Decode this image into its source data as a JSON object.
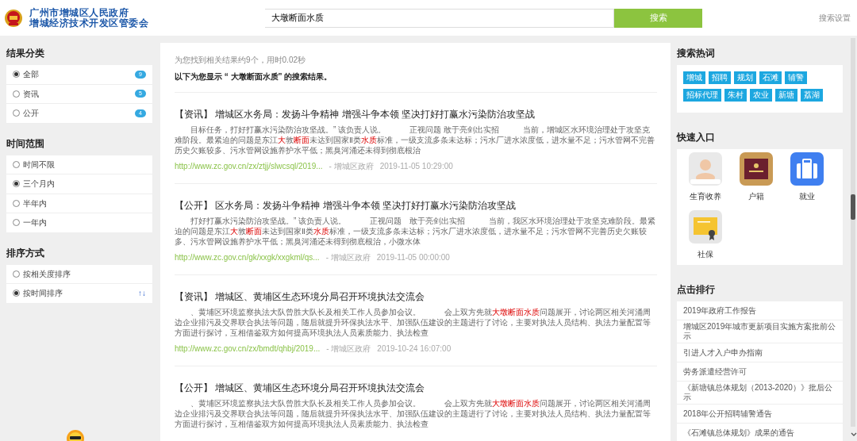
{
  "header": {
    "logo_line1": "广州市增城区人民政府",
    "logo_line2": "增城经济技术开发区管委会",
    "search": {
      "value": "大墩断面水质"
    },
    "search_button": "搜索",
    "settings_link": "搜索设置"
  },
  "filters": [
    {
      "title": "结果分类",
      "options": [
        {
          "label": "全部",
          "selected": true,
          "count": "9"
        },
        {
          "label": "资讯",
          "selected": false,
          "count": "5"
        },
        {
          "label": "公开",
          "selected": false,
          "count": "4"
        }
      ]
    },
    {
      "title": "时间范围",
      "options": [
        {
          "label": "时间不限",
          "selected": false
        },
        {
          "label": "三个月内",
          "selected": true
        },
        {
          "label": "半年内",
          "selected": false
        },
        {
          "label": "一年内",
          "selected": false
        }
      ]
    },
    {
      "title": "排序方式",
      "options": [
        {
          "label": "按相关度排序",
          "selected": false
        },
        {
          "label": "按时间排序",
          "selected": true,
          "arrows": "↑↓"
        }
      ]
    }
  ],
  "results": {
    "summary": "为您找到相关结果约9个，用时0.02秒",
    "query_line": "以下为您显示 “ 大墩断面水质” 的搜索结果。",
    "items": [
      {
        "category": "【资讯】",
        "title": "增城区水务局：发扬斗争精神 增强斗争本领 坚决打好打赢水污染防治攻坚战",
        "snippet": [
          {
            "text": "目标任务，打好打赢水污染防治攻坚战。” 该负责人说。　　　正视问题 敢于亮剑出实招　　　当前，增城区水环境治理处于攻坚克难阶段。最紧迫的问题是东江",
            "highlight": false
          },
          {
            "text": "大",
            "highlight": true
          },
          {
            "text": "敦",
            "highlight": false
          },
          {
            "text": "断面",
            "highlight": true
          },
          {
            "text": "未达到国家Ⅱ类",
            "highlight": false
          },
          {
            "text": "水质",
            "highlight": true
          },
          {
            "text": "标准，一级支流多条未达标；污水厂进水浓度低，进水量不足；污水管网不完善历史欠账较多、污水管网设施养护水平低；黑臭河涌还未得到彻底根治",
            "highlight": false
          }
        ],
        "url": "http://www.zc.gov.cn/zx/ztjj/slwcsql/2019...",
        "source": "- 增城区政府",
        "date": "2019-11-05 10:29:00"
      },
      {
        "category": "【公开】",
        "title": "区水务局：发扬斗争精神 增强斗争本领 坚决打好打赢水污染防治攻坚战",
        "snippet": [
          {
            "text": "打好打赢水污染防治攻坚战。” 该负责人说。　　　正视问题　敢于亮剑出实招　　　当前，我区水环境治理处于攻坚克难阶段。最紧迫的问题是东江",
            "highlight": false
          },
          {
            "text": "大",
            "highlight": true
          },
          {
            "text": "敦",
            "highlight": false
          },
          {
            "text": "断面",
            "highlight": true
          },
          {
            "text": "未达到国家Ⅱ类",
            "highlight": false
          },
          {
            "text": "水质",
            "highlight": true
          },
          {
            "text": "标准，一级支流多条未达标；污水厂进水浓度低，进水量不足；污水管网不完善历史欠账较多、污水管网设施养护水平低；黑臭河涌还未得到彻底根治，小微水体",
            "highlight": false
          }
        ],
        "url": "http://www.zc.gov.cn/gk/xxgk/xxgkml/qs...",
        "source": "- 增城区政府",
        "date": "2019-11-05 00:00:00"
      },
      {
        "category": "【资讯】",
        "title": "增城区、黄埔区生态环境分局召开环境执法交流会",
        "snippet": [
          {
            "text": "、黄埔区环境监察执法大队曾胜大队长及相关工作人员参加会议。　　　会上双方先就",
            "highlight": false
          },
          {
            "text": "大墩断面水质",
            "highlight": true
          },
          {
            "text": "问题展开，讨论两区相关河涌周边企业排污及交界联合执法等问题，随后就提升环保执法水平、加强队伍建设的主题进行了讨论，主要对执法人员结构、执法力量配置等方面进行探讨，互相借鉴双方如何提高环境执法人员素质能力、执法检查",
            "highlight": false
          }
        ],
        "url": "http://www.zc.gov.cn/zx/bmdt/qhbj/2019...",
        "source": "- 增城区政府",
        "date": "2019-10-24 16:07:00"
      },
      {
        "category": "【公开】",
        "title": "增城区、黄埔区生态环境分局召开环境执法交流会",
        "snippet": [
          {
            "text": "、黄埔区环境监察执法大队曾胜大队长及相关工作人员参加会议。　　　会上双方先就",
            "highlight": false
          },
          {
            "text": "大墩断面水质",
            "highlight": true
          },
          {
            "text": "问题展开，讨论两区相关河涌周边企业排污及交界联合执法等问题，随后就提升环保执法水平、加强队伍建设的主题进行了讨论，主要对执法人员结构、执法力量配置等方面进行探讨，互相借鉴双方如何提高环境执法人员素质能力、执法检查",
            "highlight": false
          }
        ]
      }
    ]
  },
  "hot_words": {
    "title": "搜索热词",
    "tags": [
      "增城",
      "招聘",
      "规划",
      "石滩",
      "辅警",
      "招标代理",
      "朱村",
      "农业",
      "新塘",
      "荔湖"
    ]
  },
  "quick_entry": {
    "title": "快速入口",
    "items": [
      {
        "label": "生育收养",
        "kind": "figure"
      },
      {
        "label": "户籍",
        "kind": "book"
      },
      {
        "label": "就业",
        "kind": "suitcase"
      },
      {
        "label": "社保",
        "kind": "certificate"
      }
    ]
  },
  "ranking": {
    "title": "点击排行",
    "items": [
      "2019年政府工作报告",
      "增城区2019年城市更新项目实施方案批前公示",
      "引进人才入户申办指南",
      "劳务派遣经营许可",
      "《新塘镇总体规划（2013-2020）》批后公示",
      "2018年公开招聘辅警通告",
      "《石滩镇总体规划》成果的通告"
    ]
  }
}
